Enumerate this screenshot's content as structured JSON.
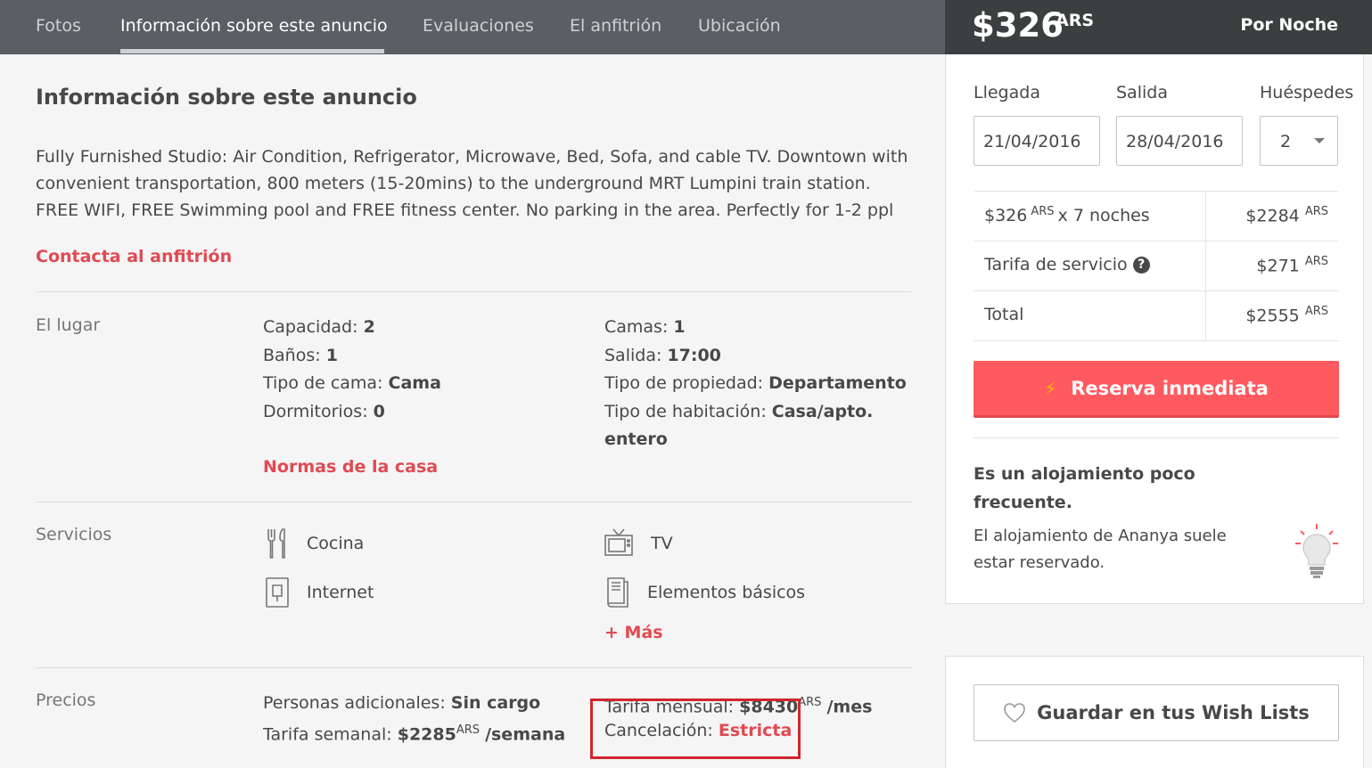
{
  "nav": {
    "tabs": [
      {
        "label": "Fotos",
        "active": false
      },
      {
        "label": "Información sobre este anuncio",
        "active": true
      },
      {
        "label": "Evaluaciones",
        "active": false
      },
      {
        "label": "El anfitrión",
        "active": false
      },
      {
        "label": "Ubicación",
        "active": false
      }
    ]
  },
  "price_header": {
    "amount": "$326",
    "currency": "ARS",
    "per": "Por Noche"
  },
  "listing": {
    "title": "Información sobre este anuncio",
    "description": "Fully Furnished Studio: Air Condition, Refrigerator, Microwave, Bed, Sofa, and cable TV. Downtown with convenient transportation, 800 meters (15-20mins) to the underground MRT Lumpini train station. FREE WIFI, FREE Swimming pool and FREE fitness center. No parking in the area. Perfectly for 1-2 ppl",
    "contact_link": "Contacta al anfitrión"
  },
  "lugar": {
    "label": "El lugar",
    "col1": [
      {
        "k": "Capacidad:",
        "v": "2"
      },
      {
        "k": "Baños:",
        "v": "1"
      },
      {
        "k": "Tipo de cama:",
        "v": "Cama"
      },
      {
        "k": "Dormitorios:",
        "v": "0"
      }
    ],
    "col2": [
      {
        "k": "Camas:",
        "v": "1"
      },
      {
        "k": "Salida:",
        "v": "17:00"
      },
      {
        "k": "Tipo de propiedad:",
        "v": "Departamento"
      },
      {
        "k": "Tipo de habitación:",
        "v": "Casa/apto."
      },
      {
        "k": "",
        "v": "entero"
      }
    ],
    "rules_link": "Normas de la casa"
  },
  "servicios": {
    "label": "Servicios",
    "items": [
      {
        "label": "Cocina",
        "icon": "utensils-icon"
      },
      {
        "label": "TV",
        "icon": "tv-icon"
      },
      {
        "label": "Internet",
        "icon": "internet-icon"
      },
      {
        "label": "Elementos básicos",
        "icon": "towel-icon"
      }
    ],
    "more_link": "+ Más"
  },
  "precios": {
    "label": "Precios",
    "extra_people_k": "Personas adicionales:",
    "extra_people_v": "Sin cargo",
    "weekly_k": "Tarifa semanal:",
    "weekly_v": "$2285",
    "weekly_cur": "ARS",
    "weekly_unit": "/semana",
    "monthly_k": "Tarifa mensual:",
    "monthly_v": "$8430",
    "monthly_cur": "ARS",
    "monthly_unit": "/mes",
    "cancel_k": "Cancelación:",
    "cancel_v": "Estricta"
  },
  "booking": {
    "checkin_label": "Llegada",
    "checkout_label": "Salida",
    "guests_label": "Huéspedes",
    "checkin": "21/04/2016",
    "checkout": "28/04/2016",
    "guests": "2",
    "rows": [
      {
        "left": "$326",
        "left_cur": "ARS",
        "left_tail": "x 7 noches",
        "right": "$2284",
        "right_cur": "ARS"
      },
      {
        "left": "Tarifa de servicio",
        "right": "$271",
        "right_cur": "ARS"
      },
      {
        "left": "Total",
        "right": "$2555",
        "right_cur": "ARS"
      }
    ],
    "reserve_label": "Reserva inmediata",
    "rare_title": "Es un alojamiento poco frecuente.",
    "rare_desc": "El alojamiento de Ananya suele estar reservado.",
    "wishlist_label": "Guardar en tus Wish Lists"
  },
  "colors": {
    "accent": "#ff5a5f",
    "link": "#e04a52",
    "nav_bg": "#5a5f63",
    "price_bg": "#3c3f40",
    "highlight": "#d0262d"
  }
}
